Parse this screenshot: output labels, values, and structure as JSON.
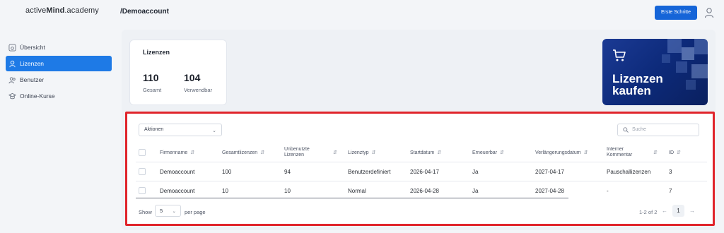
{
  "header": {
    "logo_prefix": "active",
    "logo_bold": "Mind",
    "logo_suffix": ".academy",
    "breadcrumb": "/Demoaccount",
    "first_steps_label": "Erste Schritte",
    "accent": "#1565d8"
  },
  "sidebar": {
    "items": [
      {
        "label": "Übersicht",
        "icon": "dashboard-icon",
        "active": false
      },
      {
        "label": "Lizenzen",
        "icon": "license-icon",
        "active": true
      },
      {
        "label": "Benutzer",
        "icon": "users-icon",
        "active": false
      },
      {
        "label": "Online-Kurse",
        "icon": "courses-icon",
        "active": false
      }
    ]
  },
  "stats": {
    "title": "Lizenzen",
    "total_value": "110",
    "total_label": "Gesamt",
    "usable_value": "104",
    "usable_label": "Verwendbar"
  },
  "buy": {
    "line1": "Lizenzen",
    "line2": "kaufen",
    "icon": "cart-icon"
  },
  "table": {
    "actions_label": "Aktionen",
    "search_placeholder": "Suche",
    "columns": [
      "Firmenname",
      "Gesamtlizenzen",
      "Unbenutzte Lizenzen",
      "Lizenztyp",
      "Startdatum",
      "Erneuerbar",
      "Verlängerungsdatum",
      "Interner Kommentar",
      "ID"
    ],
    "rows": [
      [
        "Demoaccount",
        "100",
        "94",
        "Benutzerdefiniert",
        "2026-04-17",
        "Ja",
        "2027-04-17",
        "Pauschallizenzen",
        "3"
      ],
      [
        "Demoaccount",
        "10",
        "10",
        "Normal",
        "2026-04-28",
        "Ja",
        "2027-04-28",
        "-",
        "7"
      ]
    ],
    "highlight_color": "#e0242b"
  },
  "pagination": {
    "show_label": "Show",
    "page_size": "5",
    "per_page_label": "per page",
    "range": "1-2 of 2",
    "current_page": "1"
  }
}
